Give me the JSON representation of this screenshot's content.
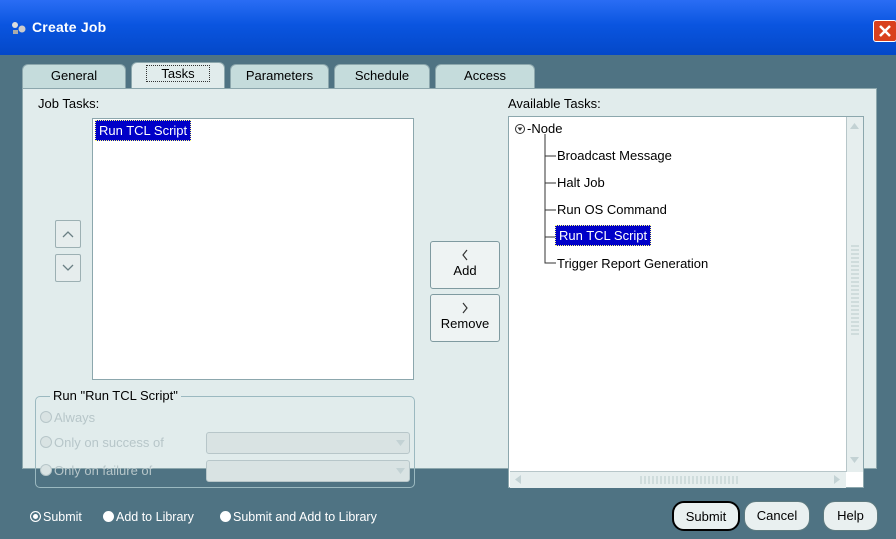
{
  "window": {
    "title": "Create Job"
  },
  "tabs": [
    {
      "label": "General",
      "active": false
    },
    {
      "label": "Tasks",
      "active": true
    },
    {
      "label": "Parameters",
      "active": false
    },
    {
      "label": "Schedule",
      "active": false
    },
    {
      "label": "Access",
      "active": false
    }
  ],
  "job_tasks": {
    "label": "Job Tasks:",
    "items": [
      "Run TCL Script"
    ],
    "selected": "Run TCL Script"
  },
  "available_tasks": {
    "label": "Available Tasks:",
    "root": "Node",
    "items": [
      "Broadcast Message",
      "Halt Job",
      "Run OS Command",
      "Run TCL Script",
      "Trigger Report Generation"
    ],
    "selected": "Run TCL Script"
  },
  "buttons": {
    "add": "Add",
    "remove": "Remove",
    "submit": "Submit",
    "cancel": "Cancel",
    "help": "Help"
  },
  "run_group": {
    "label": "Run \"Run TCL Script\"",
    "options": [
      "Always",
      "Only on success of",
      "Only on failure of"
    ]
  },
  "submit_options": [
    "Submit",
    "Add to Library",
    "Submit and Add to Library"
  ],
  "colors": {
    "titlebar": "#0a55e0",
    "background": "#4f7383",
    "panel": "#e1ecec",
    "selection": "#0000c8"
  }
}
